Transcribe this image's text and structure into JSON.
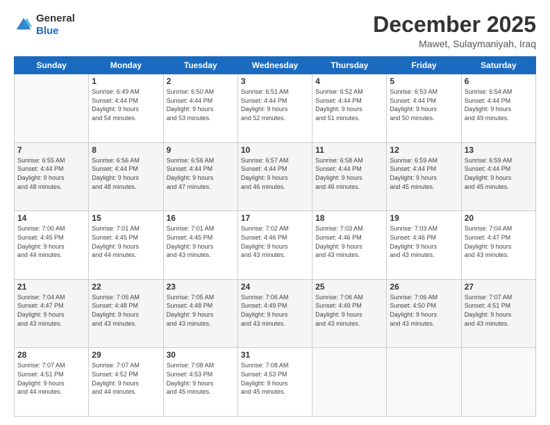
{
  "header": {
    "logo_line1": "General",
    "logo_line2": "Blue",
    "title": "December 2025",
    "location": "Mawet, Sulaymaniyah, Iraq"
  },
  "weekdays": [
    "Sunday",
    "Monday",
    "Tuesday",
    "Wednesday",
    "Thursday",
    "Friday",
    "Saturday"
  ],
  "weeks": [
    [
      {
        "day": "",
        "info": ""
      },
      {
        "day": "1",
        "info": "Sunrise: 6:49 AM\nSunset: 4:44 PM\nDaylight: 9 hours\nand 54 minutes."
      },
      {
        "day": "2",
        "info": "Sunrise: 6:50 AM\nSunset: 4:44 PM\nDaylight: 9 hours\nand 53 minutes."
      },
      {
        "day": "3",
        "info": "Sunrise: 6:51 AM\nSunset: 4:44 PM\nDaylight: 9 hours\nand 52 minutes."
      },
      {
        "day": "4",
        "info": "Sunrise: 6:52 AM\nSunset: 4:44 PM\nDaylight: 9 hours\nand 51 minutes."
      },
      {
        "day": "5",
        "info": "Sunrise: 6:53 AM\nSunset: 4:44 PM\nDaylight: 9 hours\nand 50 minutes."
      },
      {
        "day": "6",
        "info": "Sunrise: 6:54 AM\nSunset: 4:44 PM\nDaylight: 9 hours\nand 49 minutes."
      }
    ],
    [
      {
        "day": "7",
        "info": "Sunrise: 6:55 AM\nSunset: 4:44 PM\nDaylight: 9 hours\nand 48 minutes."
      },
      {
        "day": "8",
        "info": "Sunrise: 6:56 AM\nSunset: 4:44 PM\nDaylight: 9 hours\nand 48 minutes."
      },
      {
        "day": "9",
        "info": "Sunrise: 6:56 AM\nSunset: 4:44 PM\nDaylight: 9 hours\nand 47 minutes."
      },
      {
        "day": "10",
        "info": "Sunrise: 6:57 AM\nSunset: 4:44 PM\nDaylight: 9 hours\nand 46 minutes."
      },
      {
        "day": "11",
        "info": "Sunrise: 6:58 AM\nSunset: 4:44 PM\nDaylight: 9 hours\nand 46 minutes."
      },
      {
        "day": "12",
        "info": "Sunrise: 6:59 AM\nSunset: 4:44 PM\nDaylight: 9 hours\nand 45 minutes."
      },
      {
        "day": "13",
        "info": "Sunrise: 6:59 AM\nSunset: 4:44 PM\nDaylight: 9 hours\nand 45 minutes."
      }
    ],
    [
      {
        "day": "14",
        "info": "Sunrise: 7:00 AM\nSunset: 4:45 PM\nDaylight: 9 hours\nand 44 minutes."
      },
      {
        "day": "15",
        "info": "Sunrise: 7:01 AM\nSunset: 4:45 PM\nDaylight: 9 hours\nand 44 minutes."
      },
      {
        "day": "16",
        "info": "Sunrise: 7:01 AM\nSunset: 4:45 PM\nDaylight: 9 hours\nand 43 minutes."
      },
      {
        "day": "17",
        "info": "Sunrise: 7:02 AM\nSunset: 4:46 PM\nDaylight: 9 hours\nand 43 minutes."
      },
      {
        "day": "18",
        "info": "Sunrise: 7:03 AM\nSunset: 4:46 PM\nDaylight: 9 hours\nand 43 minutes."
      },
      {
        "day": "19",
        "info": "Sunrise: 7:03 AM\nSunset: 4:46 PM\nDaylight: 9 hours\nand 43 minutes."
      },
      {
        "day": "20",
        "info": "Sunrise: 7:04 AM\nSunset: 4:47 PM\nDaylight: 9 hours\nand 43 minutes."
      }
    ],
    [
      {
        "day": "21",
        "info": "Sunrise: 7:04 AM\nSunset: 4:47 PM\nDaylight: 9 hours\nand 43 minutes."
      },
      {
        "day": "22",
        "info": "Sunrise: 7:05 AM\nSunset: 4:48 PM\nDaylight: 9 hours\nand 43 minutes."
      },
      {
        "day": "23",
        "info": "Sunrise: 7:05 AM\nSunset: 4:48 PM\nDaylight: 9 hours\nand 43 minutes."
      },
      {
        "day": "24",
        "info": "Sunrise: 7:06 AM\nSunset: 4:49 PM\nDaylight: 9 hours\nand 43 minutes."
      },
      {
        "day": "25",
        "info": "Sunrise: 7:06 AM\nSunset: 4:49 PM\nDaylight: 9 hours\nand 43 minutes."
      },
      {
        "day": "26",
        "info": "Sunrise: 7:06 AM\nSunset: 4:50 PM\nDaylight: 9 hours\nand 43 minutes."
      },
      {
        "day": "27",
        "info": "Sunrise: 7:07 AM\nSunset: 4:51 PM\nDaylight: 9 hours\nand 43 minutes."
      }
    ],
    [
      {
        "day": "28",
        "info": "Sunrise: 7:07 AM\nSunset: 4:51 PM\nDaylight: 9 hours\nand 44 minutes."
      },
      {
        "day": "29",
        "info": "Sunrise: 7:07 AM\nSunset: 4:52 PM\nDaylight: 9 hours\nand 44 minutes."
      },
      {
        "day": "30",
        "info": "Sunrise: 7:08 AM\nSunset: 4:53 PM\nDaylight: 9 hours\nand 45 minutes."
      },
      {
        "day": "31",
        "info": "Sunrise: 7:08 AM\nSunset: 4:53 PM\nDaylight: 9 hours\nand 45 minutes."
      },
      {
        "day": "",
        "info": ""
      },
      {
        "day": "",
        "info": ""
      },
      {
        "day": "",
        "info": ""
      }
    ]
  ]
}
